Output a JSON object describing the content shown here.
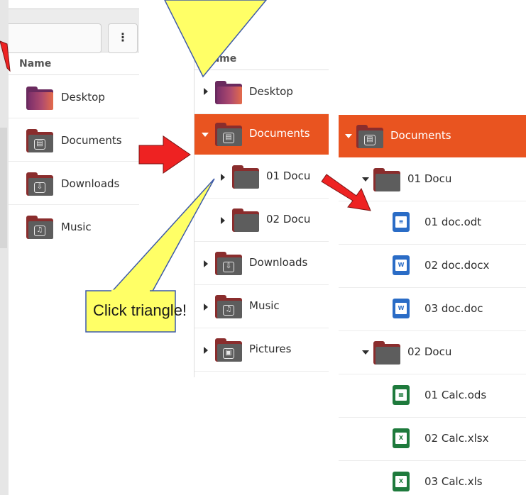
{
  "panel1": {
    "menu_icon_glyph": "⋮",
    "column_header": "Name",
    "items": [
      {
        "label": "Desktop",
        "icon": "desktop-folder-icon"
      },
      {
        "label": "Documents",
        "icon": "documents-folder-icon",
        "glyph": "▤"
      },
      {
        "label": "Downloads",
        "icon": "downloads-folder-icon",
        "glyph": "⇩"
      },
      {
        "label": "Music",
        "icon": "music-folder-icon",
        "glyph": "♫"
      }
    ]
  },
  "panel2": {
    "column_header": "Name",
    "items": [
      {
        "label": "Desktop"
      },
      {
        "label": "Documents",
        "selected": true,
        "glyph": "▤"
      },
      {
        "label": "01 Docu"
      },
      {
        "label": "02 Docu"
      },
      {
        "label": "Downloads",
        "glyph": "⇩"
      },
      {
        "label": "Music",
        "glyph": "♫"
      },
      {
        "label": "Pictures",
        "glyph": "▣"
      }
    ]
  },
  "panel3": {
    "items": [
      {
        "label": "Documents",
        "selected": true,
        "glyph": "▤"
      },
      {
        "label": "01 Docu"
      },
      {
        "label": "01 doc.odt",
        "badge": "≡"
      },
      {
        "label": "02 doc.docx",
        "badge": "W"
      },
      {
        "label": "03 doc.doc",
        "badge": "W"
      },
      {
        "label": "02 Docu"
      },
      {
        "label": "01 Calc.ods",
        "badge": "▦"
      },
      {
        "label": "02 Calc.xlsx",
        "badge": "X"
      },
      {
        "label": "03 Calc.xls",
        "badge": "X"
      }
    ]
  },
  "callout": {
    "text": "Click triangle!"
  },
  "colors": {
    "selection": "#e95420",
    "callout_fill": "#ffff66",
    "arrow": "#ee2222",
    "writer_blue": "#2a6cc6",
    "calc_green": "#1e7a3c",
    "folder_front": "#5d5d5d",
    "folder_back": "#8a2d2d"
  }
}
